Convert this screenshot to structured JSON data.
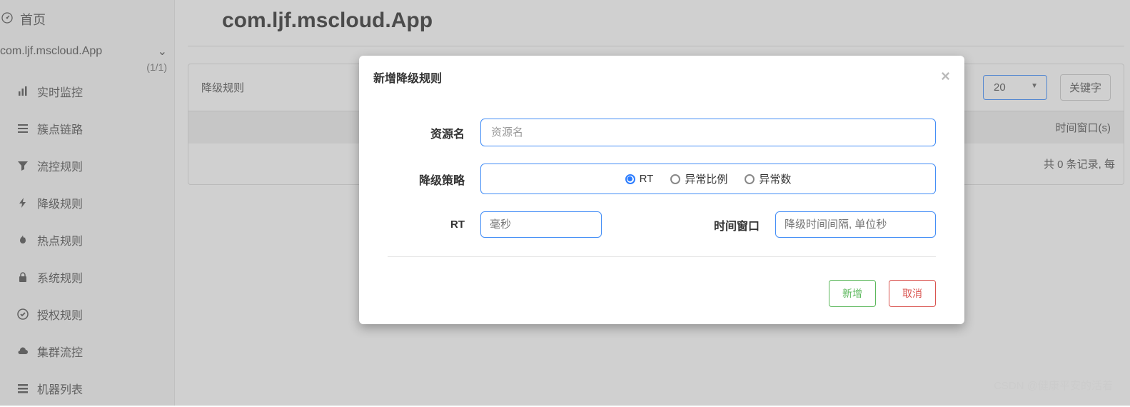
{
  "sidebar": {
    "home": "首页",
    "app_name": "com.ljf.mscloud.App",
    "app_count": "(1/1)",
    "items": [
      {
        "label": "实时监控"
      },
      {
        "label": "簇点链路"
      },
      {
        "label": "流控规则"
      },
      {
        "label": "降级规则"
      },
      {
        "label": "热点规则"
      },
      {
        "label": "系统规则"
      },
      {
        "label": "授权规则"
      },
      {
        "label": "集群流控"
      },
      {
        "label": "机器列表"
      }
    ]
  },
  "main": {
    "title": "com.ljf.mscloud.App",
    "card_title": "降级规则",
    "select_value": "20",
    "keyword_btn": "关键字",
    "table_col": "时间窗口(s)",
    "footer": "共 0 条记录, 每"
  },
  "modal": {
    "title": "新增降级规则",
    "resource_label": "资源名",
    "resource_placeholder": "资源名",
    "strategy_label": "降级策略",
    "strategies": [
      "RT",
      "异常比例",
      "异常数"
    ],
    "rt_label": "RT",
    "rt_placeholder": "毫秒",
    "window_label": "时间窗口",
    "window_placeholder": "降级时间间隔, 单位秒",
    "add_btn": "新增",
    "cancel_btn": "取消"
  },
  "watermark": "CSDN @健康平安的活着"
}
